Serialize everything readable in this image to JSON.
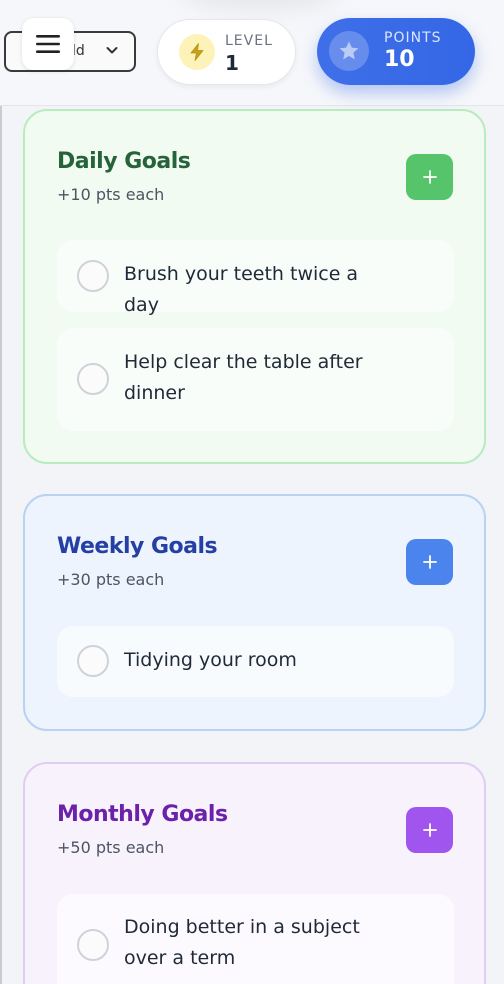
{
  "header": {
    "profile_select": {
      "value_partial": "ld"
    },
    "level": {
      "label": "LEVEL",
      "value": "1"
    },
    "points": {
      "label": "POINTS",
      "value": "10"
    }
  },
  "sections": [
    {
      "title": "Daily Goals",
      "subtitle": "+10 pts each",
      "goals": [
        {
          "text": "Brush your teeth twice a day",
          "done": false
        },
        {
          "text": "Help clear the table after dinner",
          "done": false
        }
      ]
    },
    {
      "title": "Weekly Goals",
      "subtitle": "+30 pts each",
      "goals": [
        {
          "text": "Tidying your room",
          "done": false
        }
      ]
    },
    {
      "title": "Monthly Goals",
      "subtitle": "+50 pts each",
      "goals": [
        {
          "text": "Doing better in a subject over a term",
          "done": false
        }
      ]
    }
  ],
  "colors": {
    "daily_accent": "#56c46a",
    "weekly_accent": "#4c84ee",
    "monthly_accent": "#a056ee",
    "points_card": "#3467e6"
  },
  "icons": {
    "menu": "menu-icon",
    "level": "lightning-icon",
    "points": "star-icon",
    "add": "plus-icon",
    "dropdown": "chevron-down-icon"
  }
}
